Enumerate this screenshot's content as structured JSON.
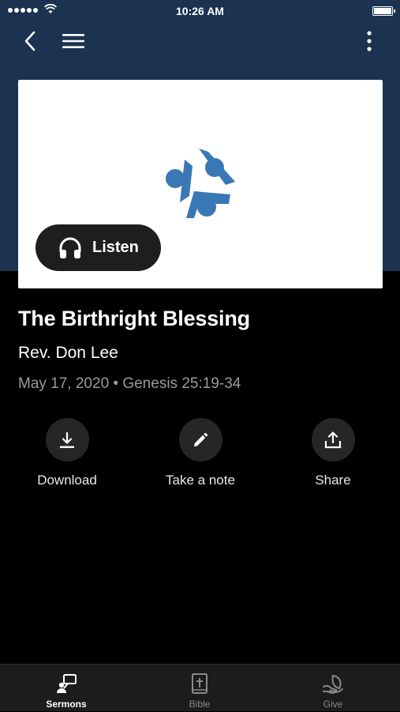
{
  "status_bar": {
    "time": "10:26 AM"
  },
  "colors": {
    "header_bg": "#1b3250",
    "logo_blue": "#3a78b5",
    "tab_active": "#ffffff",
    "tab_inactive": "#8a8a8a"
  },
  "nav": {
    "back_icon": "chevron-left-icon",
    "menu_icon": "hamburger-icon",
    "more_icon": "vertical-dots-icon"
  },
  "player": {
    "listen_label": "Listen",
    "listen_icon": "headphones-icon"
  },
  "sermon": {
    "title": "The Birthright Blessing",
    "speaker": "Rev. Don Lee",
    "meta": "May 17, 2020 • Genesis 25:19-34"
  },
  "actions": [
    {
      "label": "Download",
      "icon": "download-icon"
    },
    {
      "label": "Take a note",
      "icon": "pencil-icon"
    },
    {
      "label": "Share",
      "icon": "share-icon"
    }
  ],
  "tabs": [
    {
      "label": "Sermons",
      "icon": "sermons-icon",
      "active": true
    },
    {
      "label": "Bible",
      "icon": "bible-icon",
      "active": false
    },
    {
      "label": "Give",
      "icon": "give-icon",
      "active": false
    }
  ]
}
